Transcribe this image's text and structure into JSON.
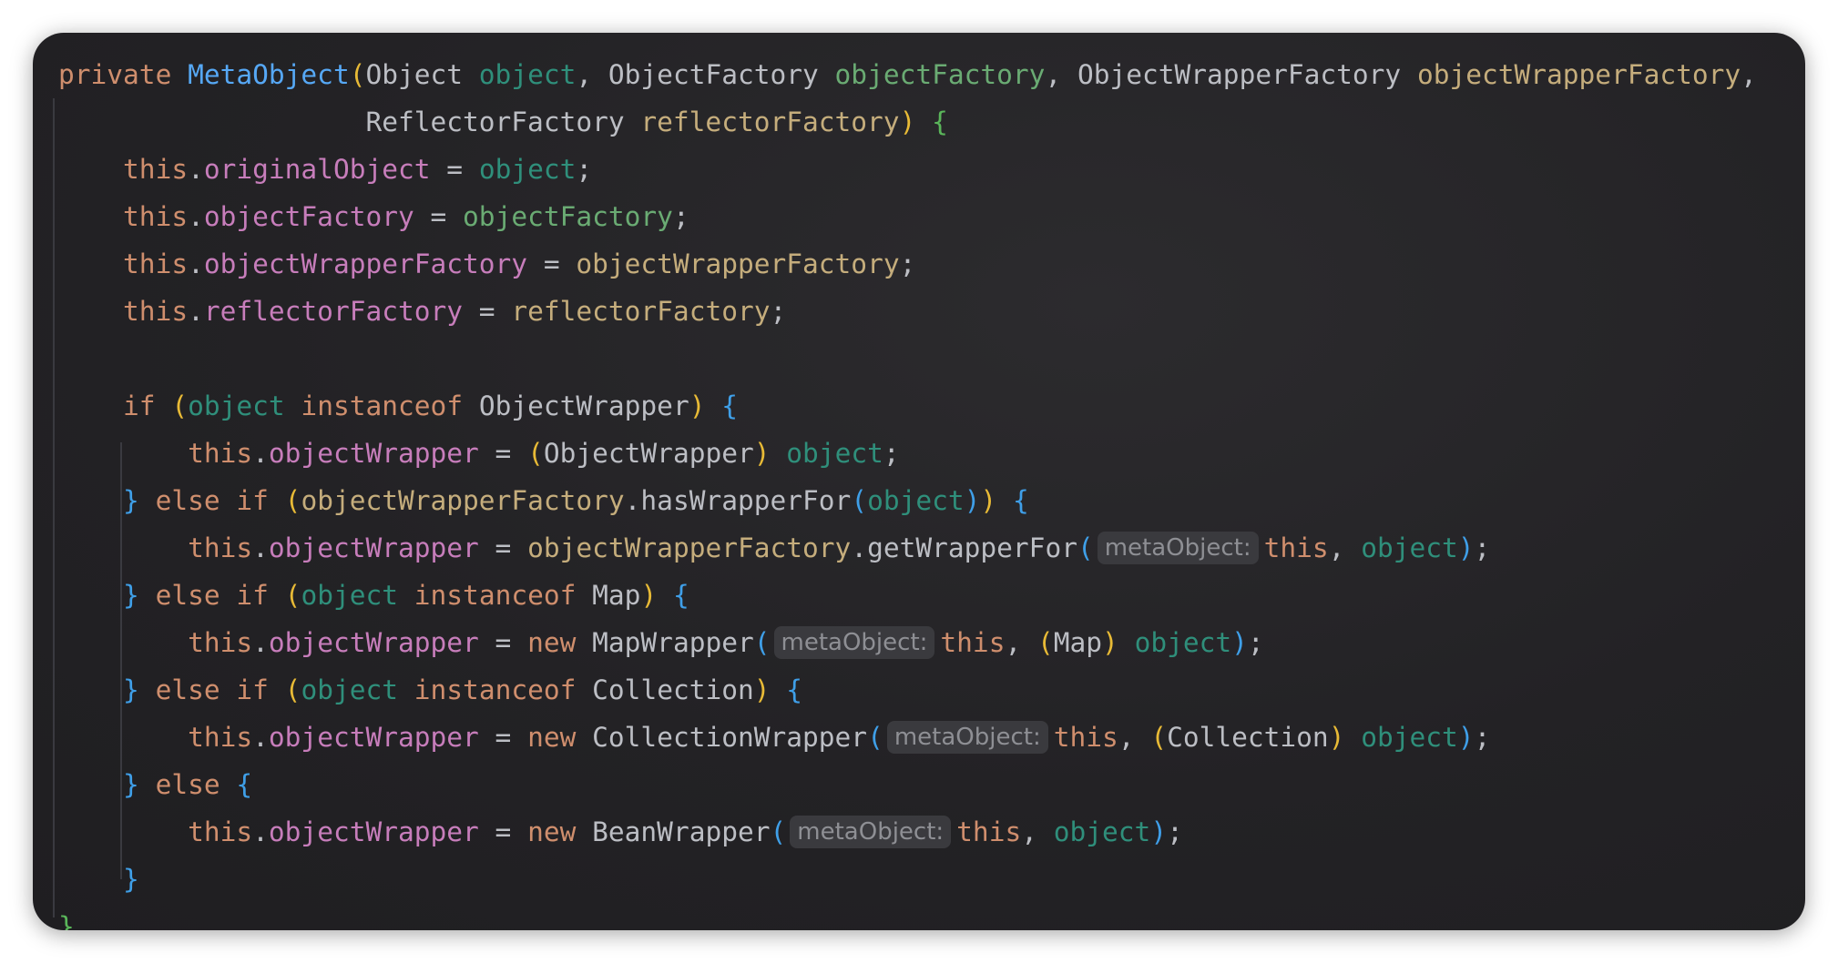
{
  "colors": {
    "keyword": "#cf8e6d",
    "method": "#56a8f5",
    "field": "#c77dbb",
    "background": "#232225"
  },
  "lines": [
    {
      "tokens": [
        {
          "t": "private ",
          "c": "kw"
        },
        {
          "t": "MetaObject",
          "c": "fn"
        },
        {
          "t": "(",
          "c": "by"
        },
        {
          "t": "Object ",
          "c": "ty"
        },
        {
          "t": "object",
          "c": "p1"
        },
        {
          "t": ", ObjectFactory ",
          "c": "pl"
        },
        {
          "t": "objectFactory",
          "c": "p2"
        },
        {
          "t": ", ObjectWrapperFactory ",
          "c": "pl"
        },
        {
          "t": "objectWrapperFactory",
          "c": "p3"
        },
        {
          "t": ",",
          "c": "pl"
        }
      ]
    },
    {
      "tokens": [
        {
          "t": "                   ReflectorFactory ",
          "c": "pl"
        },
        {
          "t": "reflectorFactory",
          "c": "p3"
        },
        {
          "t": ")",
          "c": "by"
        },
        {
          "t": " ",
          "c": "pl"
        },
        {
          "t": "{",
          "c": "bg"
        }
      ]
    },
    {
      "tokens": [
        {
          "t": "    this",
          "c": "kw"
        },
        {
          "t": ".",
          "c": "pl"
        },
        {
          "t": "originalObject",
          "c": "fd"
        },
        {
          "t": " = ",
          "c": "pl"
        },
        {
          "t": "object",
          "c": "p1"
        },
        {
          "t": ";",
          "c": "pl"
        }
      ]
    },
    {
      "tokens": [
        {
          "t": "    this",
          "c": "kw"
        },
        {
          "t": ".",
          "c": "pl"
        },
        {
          "t": "objectFactory",
          "c": "fd"
        },
        {
          "t": " = ",
          "c": "pl"
        },
        {
          "t": "objectFactory",
          "c": "p2"
        },
        {
          "t": ";",
          "c": "pl"
        }
      ]
    },
    {
      "tokens": [
        {
          "t": "    this",
          "c": "kw"
        },
        {
          "t": ".",
          "c": "pl"
        },
        {
          "t": "objectWrapperFactory",
          "c": "fd"
        },
        {
          "t": " = ",
          "c": "pl"
        },
        {
          "t": "objectWrapperFactory",
          "c": "p3"
        },
        {
          "t": ";",
          "c": "pl"
        }
      ]
    },
    {
      "tokens": [
        {
          "t": "    this",
          "c": "kw"
        },
        {
          "t": ".",
          "c": "pl"
        },
        {
          "t": "reflectorFactory",
          "c": "fd"
        },
        {
          "t": " = ",
          "c": "pl"
        },
        {
          "t": "reflectorFactory",
          "c": "p3"
        },
        {
          "t": ";",
          "c": "pl"
        }
      ]
    },
    {
      "tokens": [
        {
          "t": " ",
          "c": "pl"
        }
      ]
    },
    {
      "tokens": [
        {
          "t": "    if ",
          "c": "kw"
        },
        {
          "t": "(",
          "c": "by"
        },
        {
          "t": "object",
          "c": "p1"
        },
        {
          "t": " instanceof ",
          "c": "kw"
        },
        {
          "t": "ObjectWrapper",
          "c": "ty"
        },
        {
          "t": ")",
          "c": "by"
        },
        {
          "t": " ",
          "c": "pl"
        },
        {
          "t": "{",
          "c": "bb"
        }
      ]
    },
    {
      "tokens": [
        {
          "t": "        this",
          "c": "kw"
        },
        {
          "t": ".",
          "c": "pl"
        },
        {
          "t": "objectWrapper",
          "c": "fd"
        },
        {
          "t": " = ",
          "c": "pl"
        },
        {
          "t": "(",
          "c": "by"
        },
        {
          "t": "ObjectWrapper",
          "c": "ty"
        },
        {
          "t": ")",
          "c": "by"
        },
        {
          "t": " ",
          "c": "pl"
        },
        {
          "t": "object",
          "c": "p1"
        },
        {
          "t": ";",
          "c": "pl"
        }
      ]
    },
    {
      "tokens": [
        {
          "t": "    ",
          "c": "pl"
        },
        {
          "t": "}",
          "c": "bb"
        },
        {
          "t": " else if ",
          "c": "kw"
        },
        {
          "t": "(",
          "c": "by"
        },
        {
          "t": "objectWrapperFactory",
          "c": "p3"
        },
        {
          "t": ".hasWrapperFor",
          "c": "pl"
        },
        {
          "t": "(",
          "c": "bb"
        },
        {
          "t": "object",
          "c": "p1"
        },
        {
          "t": ")",
          "c": "bb"
        },
        {
          "t": ")",
          "c": "by"
        },
        {
          "t": " ",
          "c": "pl"
        },
        {
          "t": "{",
          "c": "bb"
        }
      ]
    },
    {
      "tokens": [
        {
          "t": "        this",
          "c": "kw"
        },
        {
          "t": ".",
          "c": "pl"
        },
        {
          "t": "objectWrapper",
          "c": "fd"
        },
        {
          "t": " = ",
          "c": "pl"
        },
        {
          "t": "objectWrapperFactory",
          "c": "p3"
        },
        {
          "t": ".getWrapperFor",
          "c": "pl"
        },
        {
          "t": "(",
          "c": "bb"
        },
        {
          "t": "metaObject:",
          "c": "hint"
        },
        {
          "t": "this",
          "c": "kw"
        },
        {
          "t": ", ",
          "c": "pl"
        },
        {
          "t": "object",
          "c": "p1"
        },
        {
          "t": ")",
          "c": "bb"
        },
        {
          "t": ";",
          "c": "pl"
        }
      ]
    },
    {
      "tokens": [
        {
          "t": "    ",
          "c": "pl"
        },
        {
          "t": "}",
          "c": "bb"
        },
        {
          "t": " else if ",
          "c": "kw"
        },
        {
          "t": "(",
          "c": "by"
        },
        {
          "t": "object",
          "c": "p1"
        },
        {
          "t": " instanceof ",
          "c": "kw"
        },
        {
          "t": "Map",
          "c": "ty"
        },
        {
          "t": ")",
          "c": "by"
        },
        {
          "t": " ",
          "c": "pl"
        },
        {
          "t": "{",
          "c": "bb"
        }
      ]
    },
    {
      "tokens": [
        {
          "t": "        this",
          "c": "kw"
        },
        {
          "t": ".",
          "c": "pl"
        },
        {
          "t": "objectWrapper",
          "c": "fd"
        },
        {
          "t": " = ",
          "c": "pl"
        },
        {
          "t": "new ",
          "c": "kw"
        },
        {
          "t": "MapWrapper",
          "c": "ty"
        },
        {
          "t": "(",
          "c": "bb"
        },
        {
          "t": "metaObject:",
          "c": "hint"
        },
        {
          "t": "this",
          "c": "kw"
        },
        {
          "t": ", ",
          "c": "pl"
        },
        {
          "t": "(",
          "c": "by"
        },
        {
          "t": "Map",
          "c": "ty"
        },
        {
          "t": ")",
          "c": "by"
        },
        {
          "t": " ",
          "c": "pl"
        },
        {
          "t": "object",
          "c": "p1"
        },
        {
          "t": ")",
          "c": "bb"
        },
        {
          "t": ";",
          "c": "pl"
        }
      ]
    },
    {
      "tokens": [
        {
          "t": "    ",
          "c": "pl"
        },
        {
          "t": "}",
          "c": "bb"
        },
        {
          "t": " else if ",
          "c": "kw"
        },
        {
          "t": "(",
          "c": "by"
        },
        {
          "t": "object",
          "c": "p1"
        },
        {
          "t": " instanceof ",
          "c": "kw"
        },
        {
          "t": "Collection",
          "c": "ty"
        },
        {
          "t": ")",
          "c": "by"
        },
        {
          "t": " ",
          "c": "pl"
        },
        {
          "t": "{",
          "c": "bb"
        }
      ]
    },
    {
      "tokens": [
        {
          "t": "        this",
          "c": "kw"
        },
        {
          "t": ".",
          "c": "pl"
        },
        {
          "t": "objectWrapper",
          "c": "fd"
        },
        {
          "t": " = ",
          "c": "pl"
        },
        {
          "t": "new ",
          "c": "kw"
        },
        {
          "t": "CollectionWrapper",
          "c": "ty"
        },
        {
          "t": "(",
          "c": "bb"
        },
        {
          "t": "metaObject:",
          "c": "hint"
        },
        {
          "t": "this",
          "c": "kw"
        },
        {
          "t": ", ",
          "c": "pl"
        },
        {
          "t": "(",
          "c": "by"
        },
        {
          "t": "Collection",
          "c": "ty"
        },
        {
          "t": ")",
          "c": "by"
        },
        {
          "t": " ",
          "c": "pl"
        },
        {
          "t": "object",
          "c": "p1"
        },
        {
          "t": ")",
          "c": "bb"
        },
        {
          "t": ";",
          "c": "pl"
        }
      ]
    },
    {
      "tokens": [
        {
          "t": "    ",
          "c": "pl"
        },
        {
          "t": "}",
          "c": "bb"
        },
        {
          "t": " else ",
          "c": "kw"
        },
        {
          "t": "{",
          "c": "bb"
        }
      ]
    },
    {
      "tokens": [
        {
          "t": "        this",
          "c": "kw"
        },
        {
          "t": ".",
          "c": "pl"
        },
        {
          "t": "objectWrapper",
          "c": "fd"
        },
        {
          "t": " = ",
          "c": "pl"
        },
        {
          "t": "new ",
          "c": "kw"
        },
        {
          "t": "BeanWrapper",
          "c": "ty"
        },
        {
          "t": "(",
          "c": "bb"
        },
        {
          "t": "metaObject:",
          "c": "hint"
        },
        {
          "t": "this",
          "c": "kw"
        },
        {
          "t": ", ",
          "c": "pl"
        },
        {
          "t": "object",
          "c": "p1"
        },
        {
          "t": ")",
          "c": "bb"
        },
        {
          "t": ";",
          "c": "pl"
        }
      ]
    },
    {
      "tokens": [
        {
          "t": "    ",
          "c": "pl"
        },
        {
          "t": "}",
          "c": "bb"
        }
      ]
    },
    {
      "tokens": [
        {
          "t": "}",
          "c": "bg"
        }
      ]
    }
  ]
}
